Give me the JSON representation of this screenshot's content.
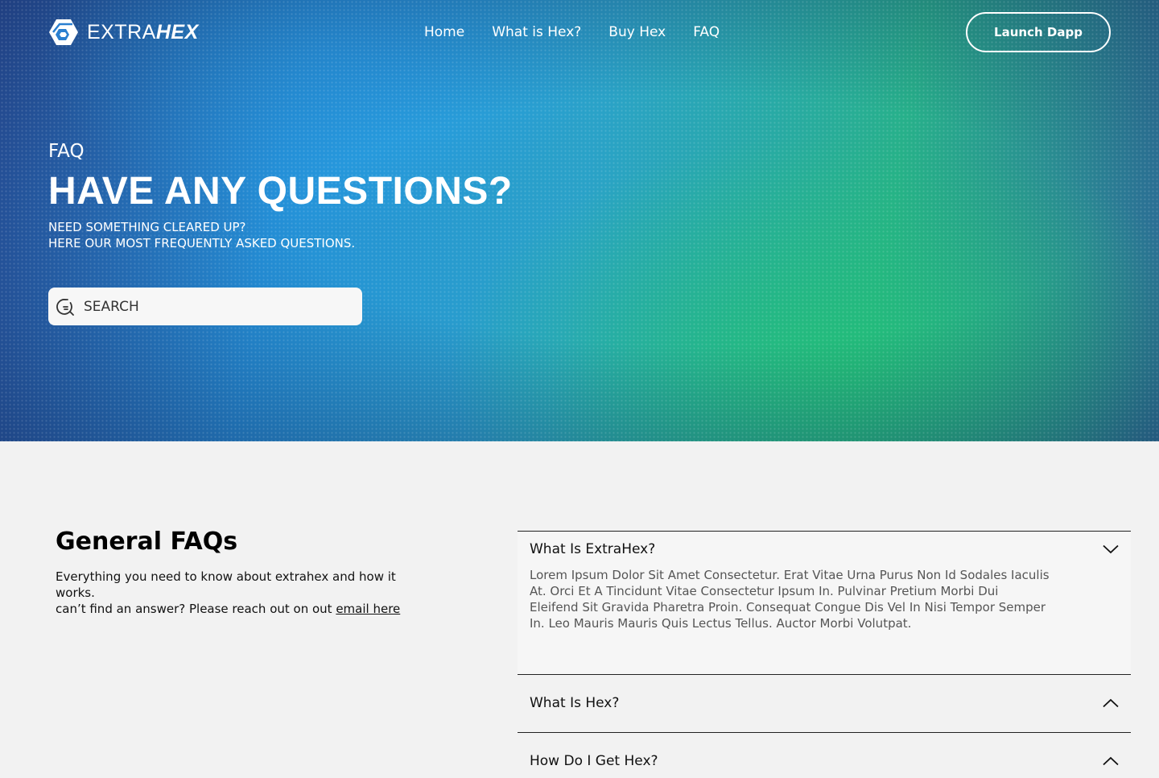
{
  "brand": {
    "name_light": "EXTRA",
    "name_bold": "HEX"
  },
  "nav": [
    {
      "label": "Home"
    },
    {
      "label": "What is Hex?"
    },
    {
      "label": "Buy Hex"
    },
    {
      "label": "FAQ"
    }
  ],
  "header": {
    "launch_label": "Launch Dapp"
  },
  "hero": {
    "eyebrow": "FAQ",
    "title": "HAVE ANY QUESTIONS?",
    "subtitle_line1": "NEED SOMETHING CLEARED UP?",
    "subtitle_line2": "HERE OUR MOST FREQUENTLY ASKED QUESTIONS.",
    "search_placeholder": "SEARCH"
  },
  "intro": {
    "title": "General FAQs",
    "text1": "Everything you need to know about extrahex and how it works.",
    "text2": "can’t find an answer? Please reach out on out ",
    "link": "email here"
  },
  "faqs": [
    {
      "question": "What Is ExtraHex?",
      "answer": "Lorem Ipsum Dolor Sit Amet Consectetur. Erat Vitae Urna Purus Non Id Sodales Iaculis At. Orci Et A Tincidunt Vitae Consectetur Ipsum In. Pulvinar Pretium Morbi Dui Eleifend Sit Gravida Pharetra Proin. Consequat Congue Dis Vel In Nisi Tempor Semper In. Leo Mauris Mauris Quis Lectus Tellus. Auctor Morbi Volutpat.",
      "expanded": true
    },
    {
      "question": "What Is Hex?",
      "expanded": false
    },
    {
      "question": "How Do I Get Hex?",
      "expanded": false
    }
  ],
  "colors": {
    "hero_blue": "#2490d8",
    "hero_green": "#22be78",
    "page_bg": "#f2f2f2"
  }
}
